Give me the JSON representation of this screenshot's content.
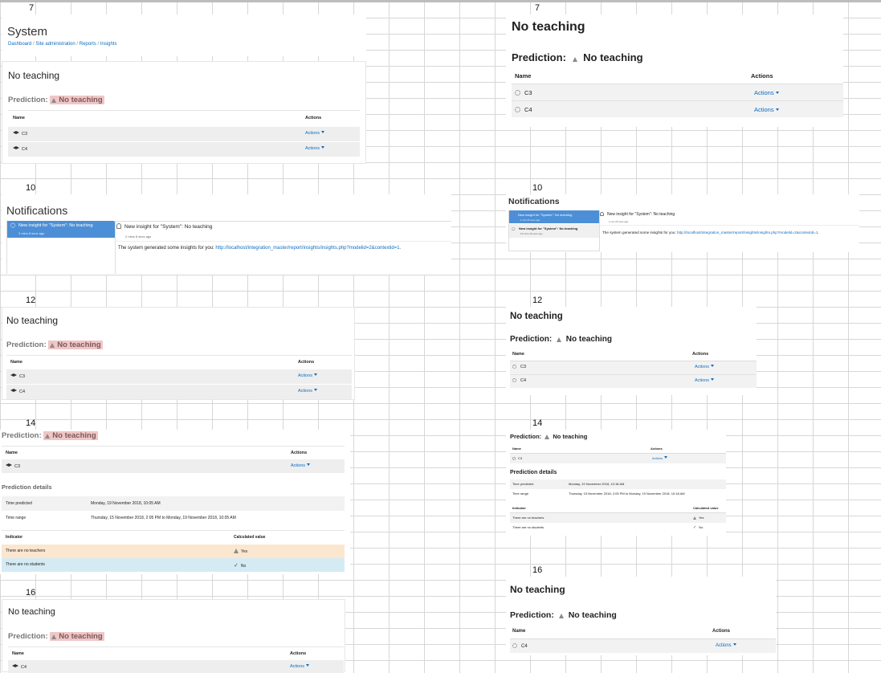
{
  "common": {
    "site_title": "System",
    "breadcrumb": [
      "Dashboard",
      "Site administration",
      "Reports",
      "Insights"
    ],
    "breadcrumb_sep": "/",
    "heading": "No teaching",
    "prediction_label": "Prediction:",
    "prediction_value": "No teaching",
    "col_name": "Name",
    "col_actions": "Actions",
    "action_label": "Actions",
    "course_c3": "C3",
    "course_c4": "C4"
  },
  "row_numbers": [
    "7",
    "7",
    "10",
    "10",
    "12",
    "12",
    "14",
    "14",
    "16",
    "16"
  ],
  "notifications": {
    "title": "Notifications",
    "list_item": "New insight for \"System\": No teaching",
    "list_item_time_left": "2 mins 8 secs ago",
    "list_item1_time_right": "1 min 26 secs ago",
    "list_item2_time_right": "19 mins 49 secs ago",
    "detail_title": "New insight for \"System\": No teaching",
    "detail_time_left": "2 mins 8 secs ago",
    "detail_time_right": "1 min 26 secs ago",
    "body_text": "The system generated some insights for you:",
    "body_link": "http://localhost/integration_master/report/insights/insights.php?modelid=2&contextid=1."
  },
  "prediction_details": {
    "title": "Prediction details",
    "time_predicted_label": "Time predicted",
    "time_range_label": "Time range",
    "left_time_predicted": "Monday, 19 November 2018, 10:05 AM",
    "left_time_range": "Thursday, 15 November 2018, 2:05 PM to Monday, 19 November 2018, 10:05 AM",
    "right_time_predicted": "Monday, 19 November 2018, 10:18 AM",
    "right_time_range": "Thursday, 15 November 2018, 2:05 PM to Monday, 19 November 2018, 10:18 AM",
    "col_indicator": "Indicator",
    "col_calculated": "Calculated value",
    "ind_teachers": "There are no teachers",
    "ind_students": "There are no students",
    "val_yes": "Yes",
    "val_no": "No"
  },
  "colors": {
    "link": "#0f6cbf",
    "highlight": "#f0c6c6",
    "selected": "#4d8fd6",
    "warning_row": "#fbe6cf",
    "info_row": "#d4ebf3"
  },
  "icons": [
    "warning-icon",
    "graduation-cap-icon",
    "gear-icon",
    "bell-icon",
    "check-icon",
    "caret-down-icon"
  ]
}
